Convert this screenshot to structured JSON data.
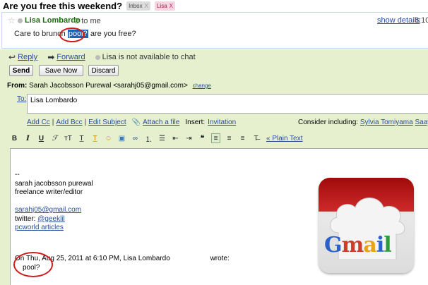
{
  "subject": {
    "title": "Are you free this weekend?",
    "labels": [
      {
        "name": "Inbox",
        "remove": "X"
      },
      {
        "name": "Lisa",
        "remove": "X"
      }
    ]
  },
  "message": {
    "sender": "Lisa Lombardo",
    "to": "to me",
    "show_details": "show details",
    "time": "6:10",
    "snippet_before": "Care to brunch",
    "snippet_highlight": "pool?",
    "snippet_after": "are you free?"
  },
  "reply_actions": {
    "reply": "Reply",
    "forward": "Forward",
    "chat_status": "Lisa is not available to chat"
  },
  "buttons": {
    "send": "Send",
    "save_now": "Save Now",
    "discard": "Discard"
  },
  "from": {
    "label": "From:",
    "value": "Sarah Jacobsson Purewal <sarahj05@gmail.com>",
    "change": "change"
  },
  "to": {
    "label": "To:",
    "value": "Lisa Lombardo"
  },
  "compose_links": {
    "add_cc": "Add Cc",
    "add_bcc": "Add Bcc",
    "edit_subject": "Edit Subject",
    "attach": "Attach a file",
    "insert": "Insert:",
    "invitation": "Invitation",
    "consider": "Consider including:",
    "suggest_1": "Sylvia Tomiyama",
    "suggest_2": "Saaya S"
  },
  "toolbar": {
    "plain_text": "« Plain Text",
    "icons": [
      "bold-icon",
      "italic-icon",
      "underline-icon",
      "font-icon",
      "text-size-icon",
      "text-color-icon",
      "highlight-color-icon",
      "emoticon-icon",
      "image-icon",
      "link-icon",
      "numbered-list-icon",
      "bulleted-list-icon",
      "outdent-icon",
      "indent-icon",
      "quote-icon",
      "align-left-icon",
      "align-center-icon",
      "align-right-icon",
      "remove-formatting-icon"
    ]
  },
  "body": {
    "sig_dash": "--",
    "sig_name": "sarah jacobsson purewal",
    "sig_title": "freelance writer/editor",
    "sig_email": "sarahj05@gmail.com",
    "sig_twitter_prefix": "twitter: ",
    "sig_twitter": "@geeklil",
    "sig_articles": "pcworld articles",
    "quote_header": "On Thu, Aug 25, 2011 at 6:10 PM, Lisa Lombardo",
    "quote_wrote": "wrote:",
    "quote_text": "pool?"
  },
  "logo": {
    "text": "Gmail",
    "colors": {
      "G": "#2a62c9",
      "m": "#d33a2a",
      "a": "#e8a317",
      "i": "#2a62c9",
      "l": "#2c9c3a"
    }
  }
}
